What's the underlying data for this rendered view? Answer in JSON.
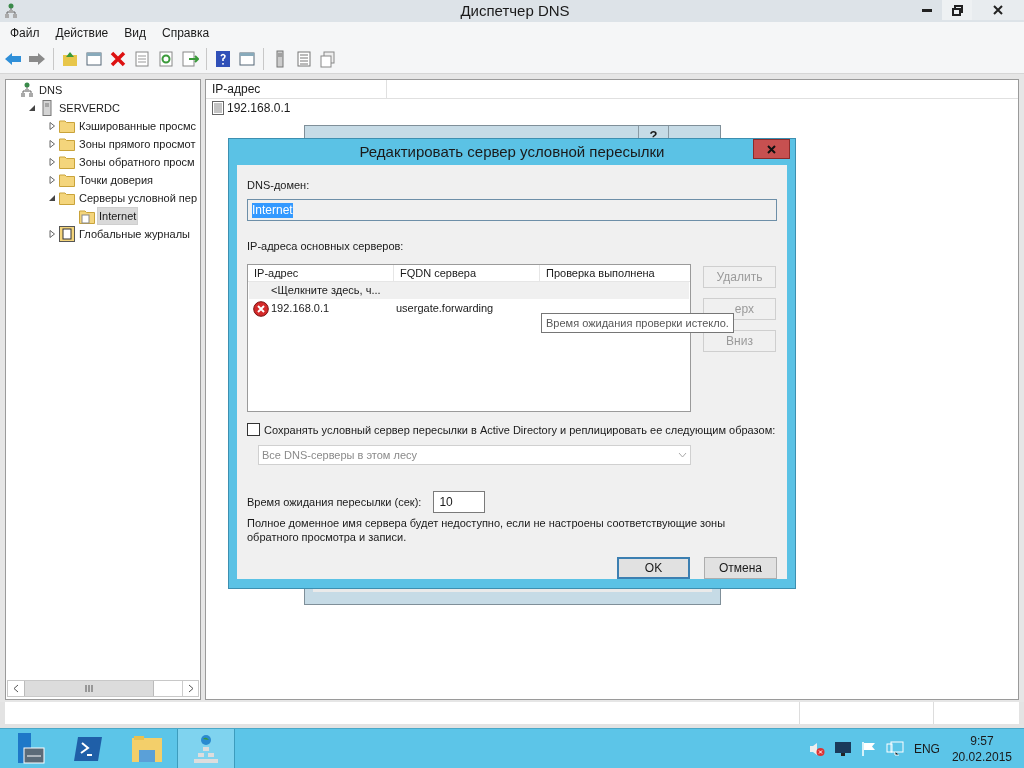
{
  "window": {
    "title": "Диспетчер DNS"
  },
  "menu": [
    "Файл",
    "Действие",
    "Вид",
    "Справка"
  ],
  "tree": [
    {
      "label": "DNS",
      "kind": "dns",
      "selected": false,
      "children": [
        {
          "label": "SERVERDC",
          "kind": "server",
          "expanded": true,
          "selected": false,
          "children": [
            {
              "label": "Кэшированные просмс",
              "kind": "folder",
              "expanded": false,
              "selected": false
            },
            {
              "label": "Зоны прямого просмот",
              "kind": "folder",
              "expanded": false,
              "selected": false
            },
            {
              "label": "Зоны обратного просм",
              "kind": "folder",
              "expanded": false,
              "selected": false
            },
            {
              "label": "Точки доверия",
              "kind": "folder",
              "expanded": false,
              "selected": false
            },
            {
              "label": "Серверы условной пер",
              "kind": "folder",
              "expanded": true,
              "selected": false,
              "children": [
                {
                  "label": "Internet",
                  "kind": "zone",
                  "selected": true
                }
              ]
            },
            {
              "label": "Глобальные журналы",
              "kind": "log",
              "expanded": false,
              "selected": false
            }
          ]
        }
      ]
    }
  ],
  "list": {
    "columns": [
      "IP-адрес"
    ],
    "rows": [
      {
        "ip": "192.168.0.1"
      }
    ]
  },
  "background_dialog": {
    "help": "?"
  },
  "dialog": {
    "title": "Редактировать сервер условной пересылки",
    "domain_label": "DNS-домен:",
    "domain_value": "Internet",
    "domain_text_selected": true,
    "servers_label": "IP-адреса основных серверов:",
    "columns": [
      "IP-адрес",
      "FQDN сервера",
      "Проверка выполнена"
    ],
    "rows": [
      {
        "kind": "add",
        "ip": "<Щелкните здесь, ч..."
      },
      {
        "kind": "server",
        "error": true,
        "ip": "192.168.0.1",
        "fqdn": "usergate.forwarding"
      }
    ],
    "tooltip": "Время ожидания проверки истекло.",
    "side_buttons": [
      {
        "label": "Удалить",
        "disabled": true
      },
      {
        "label": "ерх",
        "disabled": true
      },
      {
        "label": "Вниз",
        "disabled": true
      }
    ],
    "ad_checkbox": {
      "label": "Сохранять условный сервер пересылки в Active Directory и реплицировать ее следующим образом:",
      "checked": false
    },
    "replication": {
      "value": "Все DNS-серверы в этом лесу",
      "disabled": true
    },
    "timeout_label": "Время ожидания пересылки (сек):",
    "timeout_value": "10",
    "note": "Полное доменное имя сервера будет недоступно, если не настроены соответствующие зоны обратного просмотра и записи.",
    "buttons": [
      {
        "label": "OK",
        "default": true
      },
      {
        "label": "Отмена",
        "default": false
      }
    ]
  },
  "taskbar": {
    "apps": [
      {
        "kind": "server-manager",
        "selected": false
      },
      {
        "kind": "powershell",
        "selected": false
      },
      {
        "kind": "explorer",
        "selected": false
      },
      {
        "kind": "dns",
        "selected": true
      }
    ],
    "language": "ENG",
    "time": "9:57",
    "date": "20.02.2015"
  }
}
